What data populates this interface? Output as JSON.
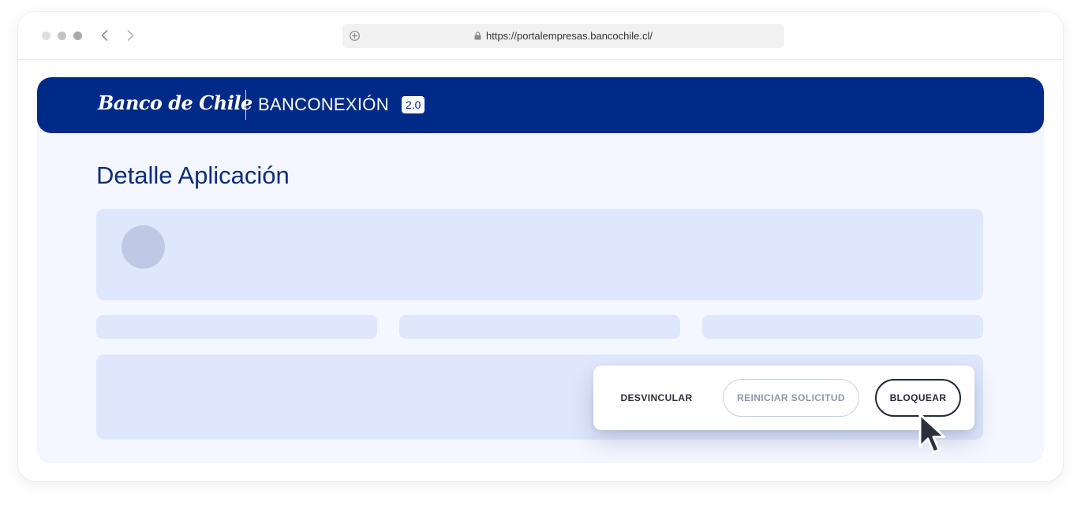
{
  "browser": {
    "url": "https://portalempresas.bancochile.cl/"
  },
  "header": {
    "logo_text": "Banco de Chile",
    "product_name": "BANCONEXIÓN",
    "version": "2.0"
  },
  "main": {
    "title": "Detalle Aplicación"
  },
  "actions": {
    "unlink_label": "DESVINCULAR",
    "restart_label": "REINICIAR SOLICITUD",
    "block_label": "BLOQUEAR"
  },
  "colors": {
    "brand_blue": "#002a87",
    "page_bg": "#f4f7ff",
    "skeleton": "#dfe7fc"
  }
}
